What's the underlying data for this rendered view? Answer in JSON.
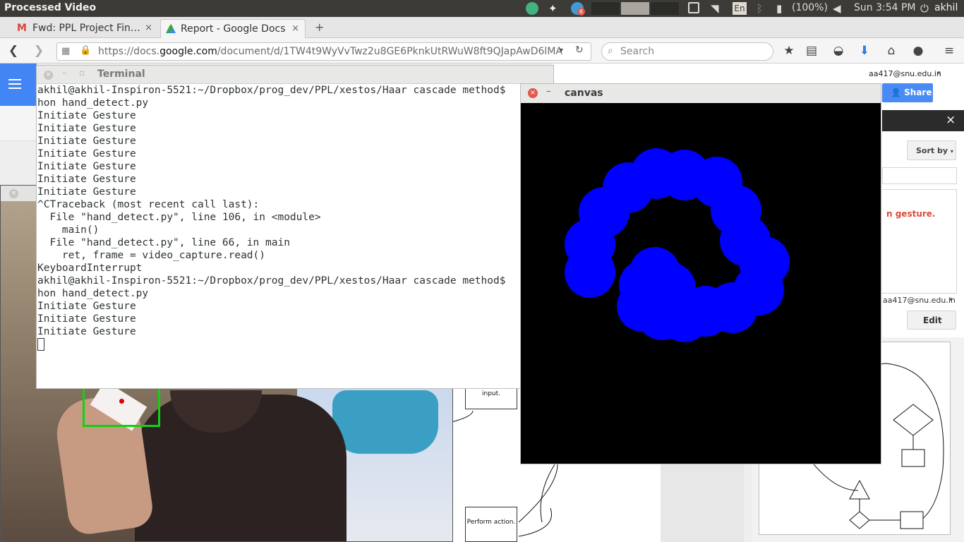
{
  "topbar": {
    "app_title": "Processed Video",
    "notification_count": "6",
    "keyboard_layout": "En",
    "battery": "(100%)",
    "clock": "Sun  3:54 PM",
    "user": "akhil"
  },
  "browser": {
    "tabs": [
      {
        "label": "Fwd: PPL Project Fin…",
        "close": "×"
      },
      {
        "label": "Report - Google Docs",
        "close": "×"
      }
    ],
    "new_tab": "+",
    "url_prefix": "https://docs.",
    "url_domain": "google.com",
    "url_rest": "/document/d/1TW4t9WyVvTwz2u8GE6PknkUtRWuW8ft9QJapAwD6lMA",
    "search_placeholder": "Search"
  },
  "docs": {
    "account": "aa417@snu.edu.in",
    "share": "Share",
    "panel_close": "×",
    "sort_by": "Sort by",
    "comment_text": "n gesture.",
    "comment_account": "aa417@snu.edu.in",
    "edit": "Edit",
    "flow_input": "input.",
    "flow_perform": "Perform action."
  },
  "terminal": {
    "title": "Terminal",
    "lines": [
      "akhil@akhil-Inspiron-5521:~/Dropbox/prog_dev/PPL/xestos/Haar cascade method$",
      "hon hand_detect.py",
      "Initiate Gesture",
      "Initiate Gesture",
      "Initiate Gesture",
      "Initiate Gesture",
      "Initiate Gesture",
      "Initiate Gesture",
      "Initiate Gesture",
      "^CTraceback (most recent call last):",
      "  File \"hand_detect.py\", line 106, in <module>",
      "    main()",
      "  File \"hand_detect.py\", line 66, in main",
      "    ret, frame = video_capture.read()",
      "KeyboardInterrupt",
      "akhil@akhil-Inspiron-5521:~/Dropbox/prog_dev/PPL/xestos/Haar cascade method$",
      "hon hand_detect.py",
      "Initiate Gesture",
      "Initiate Gesture",
      "Initiate Gesture"
    ]
  },
  "canvas": {
    "title": "canvas",
    "stroke_color": "#0000ff",
    "background": "#000000"
  },
  "colors": {
    "panel": "#3c3b37",
    "docs_blue": "#4285f4",
    "share_blue": "#4a8af4",
    "comment_red": "#dd4b39",
    "close_red": "#e2574c"
  }
}
